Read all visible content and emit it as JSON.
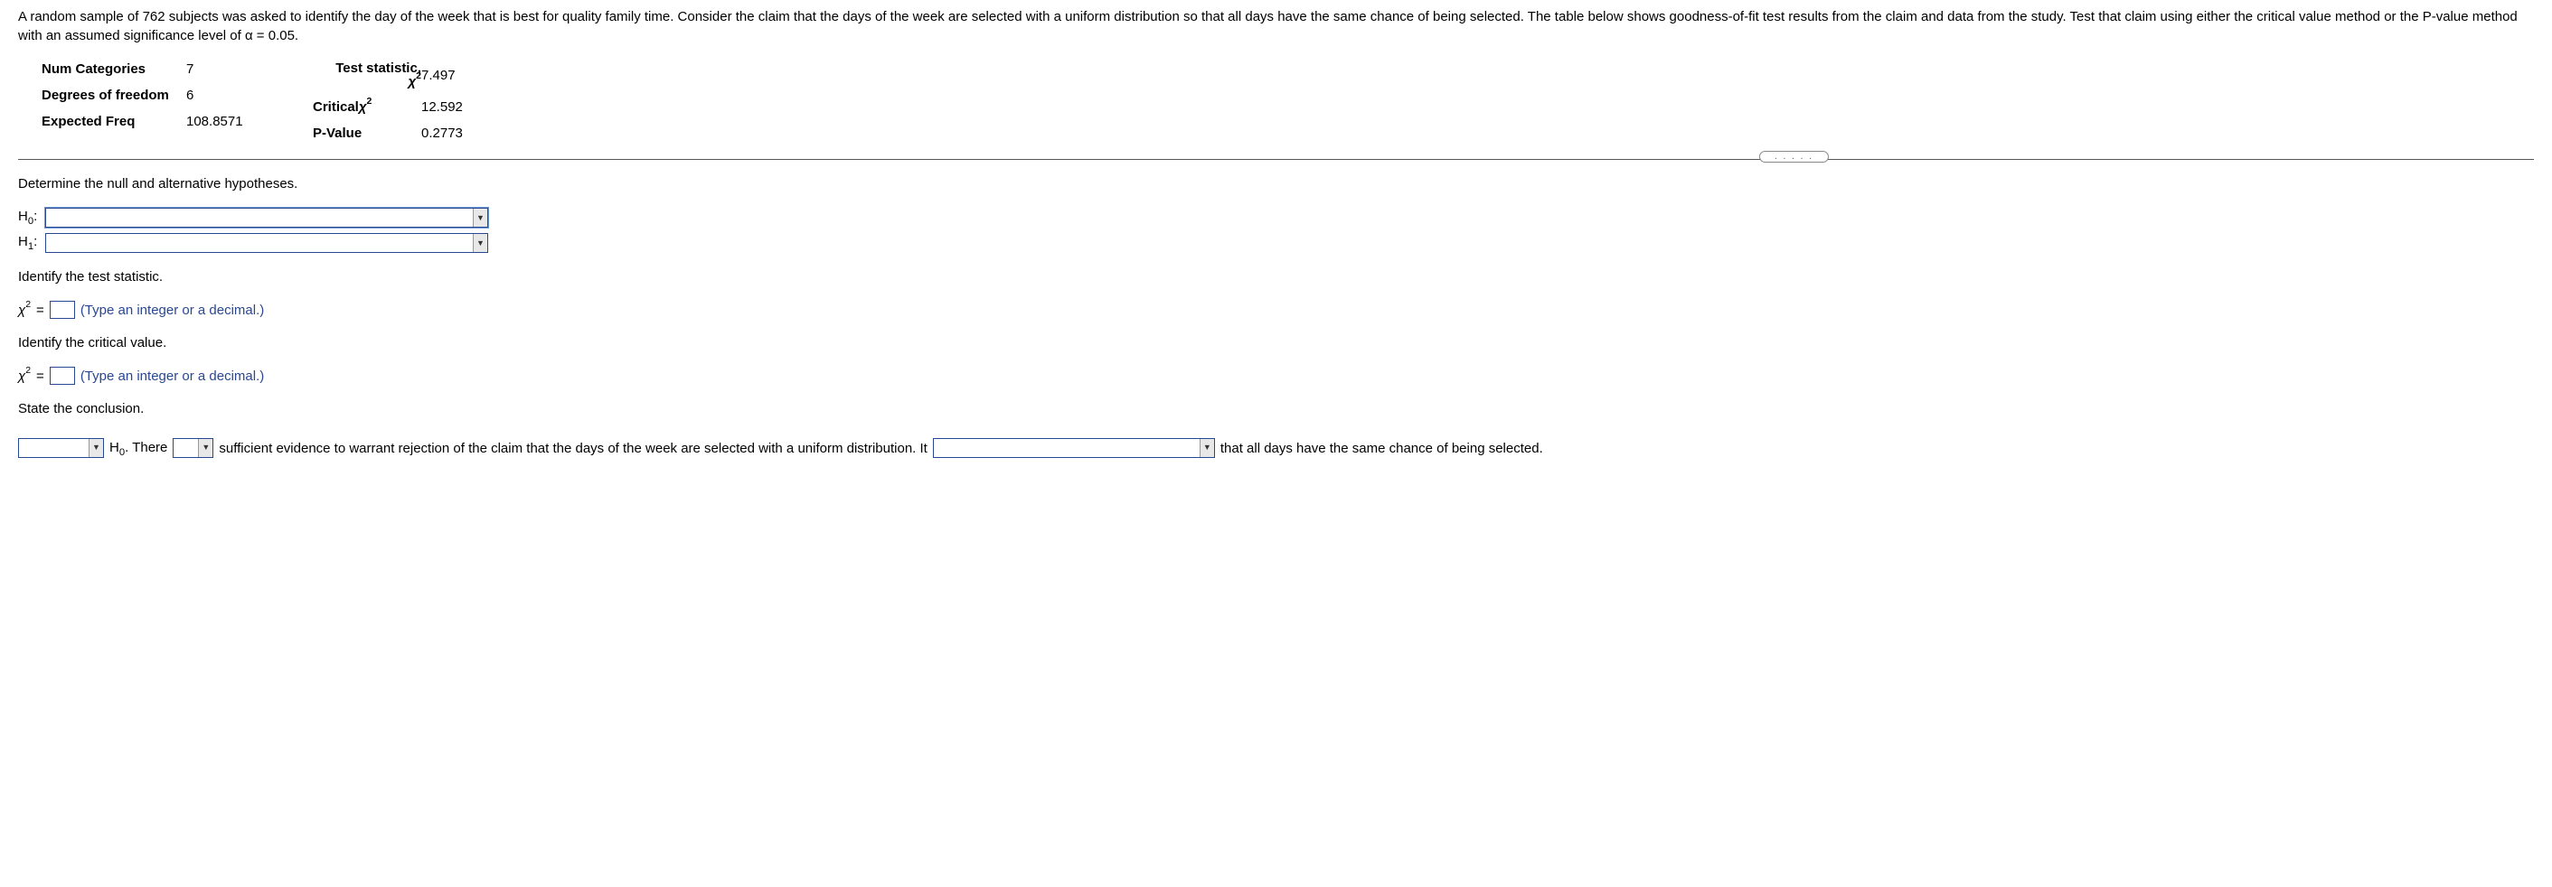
{
  "intro": "A random sample of 762 subjects was asked to identify the day of the week that is best for quality family time. Consider the claim that the days of the week are selected with a uniform distribution so that all days have the same chance of being selected. The table below shows goodness-of-fit test results from the claim and data from the study. Test that claim using either the critical value method or the P-value method with an assumed significance level of α = 0.05.",
  "table": {
    "num_categories_label": "Num Categories",
    "num_categories_value": "7",
    "degrees_freedom_label": "Degrees of freedom",
    "degrees_freedom_value": "6",
    "expected_freq_label": "Expected Freq",
    "expected_freq_value": "108.8571",
    "test_stat_label_line1": "Test statistic,",
    "test_stat_value": "7.497",
    "critical_label_prefix": "Critical ",
    "critical_value": "12.592",
    "pvalue_label": "P-Value",
    "pvalue_value": "0.2773"
  },
  "q_hypotheses": "Determine the null and alternative hypotheses.",
  "h0_label": "H",
  "h0_sub": "0",
  "h1_label": "H",
  "h1_sub": "1",
  "colon": ":",
  "q_test_stat": "Identify the test statistic.",
  "chi": "χ",
  "two": "2",
  "eq": "=",
  "hint_int_dec": "(Type an integer or a decimal.)",
  "q_critical": "Identify the critical value.",
  "q_conclusion": "State the conclusion.",
  "conclusion": {
    "h0_text": " H",
    "period": ". ",
    "there": "There ",
    "mid1": " sufficient evidence to warrant rejection of the claim that the days of the week are selected with a uniform distribution. It ",
    "tail": " that all days have the same chance of being selected."
  },
  "ellipsis": ". . . . ."
}
